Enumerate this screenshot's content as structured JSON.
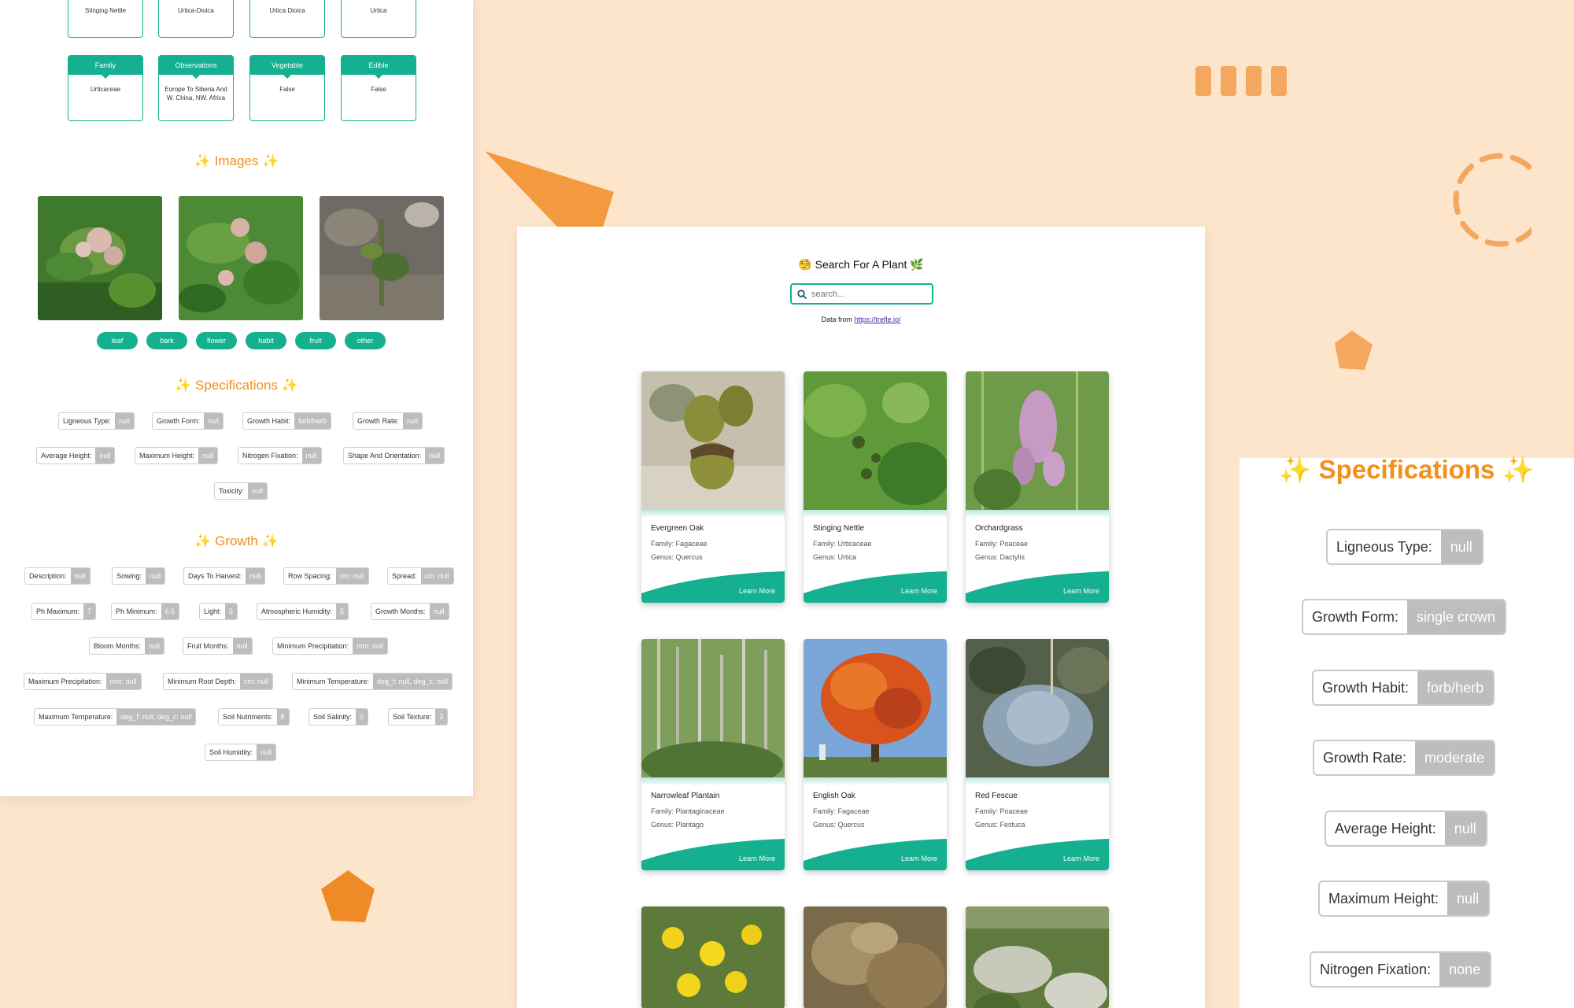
{
  "left_page": {
    "top_values": [
      "Stinging Nettle",
      "Urtica-Dioica",
      "Urtica Dioica",
      "Urtica"
    ],
    "info_cards": [
      {
        "label": "Family",
        "value": "Urticaceae"
      },
      {
        "label": "Observations",
        "value": "Europe To Siberia And W. China, NW. Africa"
      },
      {
        "label": "Vegetable",
        "value": "False"
      },
      {
        "label": "Edible",
        "value": "False"
      }
    ],
    "images_title": "✨ Images ✨",
    "image_tabs": [
      "leaf",
      "bark",
      "flower",
      "habit",
      "fruit",
      "other"
    ],
    "specifications_title": "✨ Specifications ✨",
    "specifications": [
      {
        "key": "Ligneous Type:",
        "value": "null"
      },
      {
        "key": "Growth Form:",
        "value": "null"
      },
      {
        "key": "Growth Habit:",
        "value": "forb/herb"
      },
      {
        "key": "Growth Rate:",
        "value": "null"
      },
      {
        "key": "Average Height:",
        "value": "null"
      },
      {
        "key": "Maximum Height:",
        "value": "null"
      },
      {
        "key": "Nitrogen Fixation:",
        "value": "null"
      },
      {
        "key": "Shape And Orientation:",
        "value": "null"
      },
      {
        "key": "Toxicity:",
        "value": "null"
      }
    ],
    "growth_title": "✨ Growth ✨",
    "growth": [
      {
        "key": "Description:",
        "value": "null"
      },
      {
        "key": "Sowing:",
        "value": "null"
      },
      {
        "key": "Days To Harvest:",
        "value": "null"
      },
      {
        "key": "Row Spacing:",
        "value": "cm: null"
      },
      {
        "key": "Spread:",
        "value": "cm: null"
      },
      {
        "key": "Ph Maximum:",
        "value": "7"
      },
      {
        "key": "Ph Minimum:",
        "value": "6.5"
      },
      {
        "key": "Light:",
        "value": "5"
      },
      {
        "key": "Atmospheric Humidity:",
        "value": "5"
      },
      {
        "key": "Growth Months:",
        "value": "null"
      },
      {
        "key": "Bloom Months:",
        "value": "null"
      },
      {
        "key": "Fruit Months:",
        "value": "null"
      },
      {
        "key": "Minimum Precipitation:",
        "value": "mm: null"
      },
      {
        "key": "Maximum Precipitation:",
        "value": "mm: null"
      },
      {
        "key": "Minimum Root Depth:",
        "value": "cm: null"
      },
      {
        "key": "Minimum Temperature:",
        "value": "deg_f: null, deg_c: null"
      },
      {
        "key": "Maximum Temperature:",
        "value": "deg_f: null, deg_c: null"
      },
      {
        "key": "Soil Nutriments:",
        "value": "8"
      },
      {
        "key": "Soil Salinity:",
        "value": "0"
      },
      {
        "key": "Soil Texture:",
        "value": "3"
      },
      {
        "key": "Soil Humidity:",
        "value": "null"
      }
    ]
  },
  "search_page": {
    "title": "🧐 Search For A Plant 🌿",
    "search_placeholder": "search...",
    "data_from_prefix": "Data from ",
    "data_from_link": "https://trefle.io/",
    "plants": [
      {
        "name": "Evergreen Oak",
        "family": "Family: Fagaceae",
        "genus": "Genus: Quercus",
        "cta": "Learn More"
      },
      {
        "name": "Stinging Nettle",
        "family": "Family: Urticaceae",
        "genus": "Genus: Urtica",
        "cta": "Learn More"
      },
      {
        "name": "Orchardgrass",
        "family": "Family: Poaceae",
        "genus": "Genus: Dactylis",
        "cta": "Learn More"
      },
      {
        "name": "Narrowleaf Plantain",
        "family": "Family: Plantaginaceae",
        "genus": "Genus: Plantago",
        "cta": "Learn More"
      },
      {
        "name": "English Oak",
        "family": "Family: Fagaceae",
        "genus": "Genus: Quercus",
        "cta": "Learn More"
      },
      {
        "name": "Red Fescue",
        "family": "Family: Poaceae",
        "genus": "Genus: Festuca",
        "cta": "Learn More"
      }
    ]
  },
  "right_panel": {
    "title": "✨ Specifications ✨",
    "specifications": [
      {
        "key": "Ligneous Type:",
        "value": "null"
      },
      {
        "key": "Growth Form:",
        "value": "single crown"
      },
      {
        "key": "Growth Habit:",
        "value": "forb/herb"
      },
      {
        "key": "Growth Rate:",
        "value": "moderate"
      },
      {
        "key": "Average Height:",
        "value": "null"
      },
      {
        "key": "Maximum Height:",
        "value": "null"
      },
      {
        "key": "Nitrogen Fixation:",
        "value": "none"
      }
    ]
  },
  "colors": {
    "accent": "#14b08f",
    "orange": "#f39019",
    "background": "#fde5cc",
    "value_gray": "#bdbdbd"
  }
}
